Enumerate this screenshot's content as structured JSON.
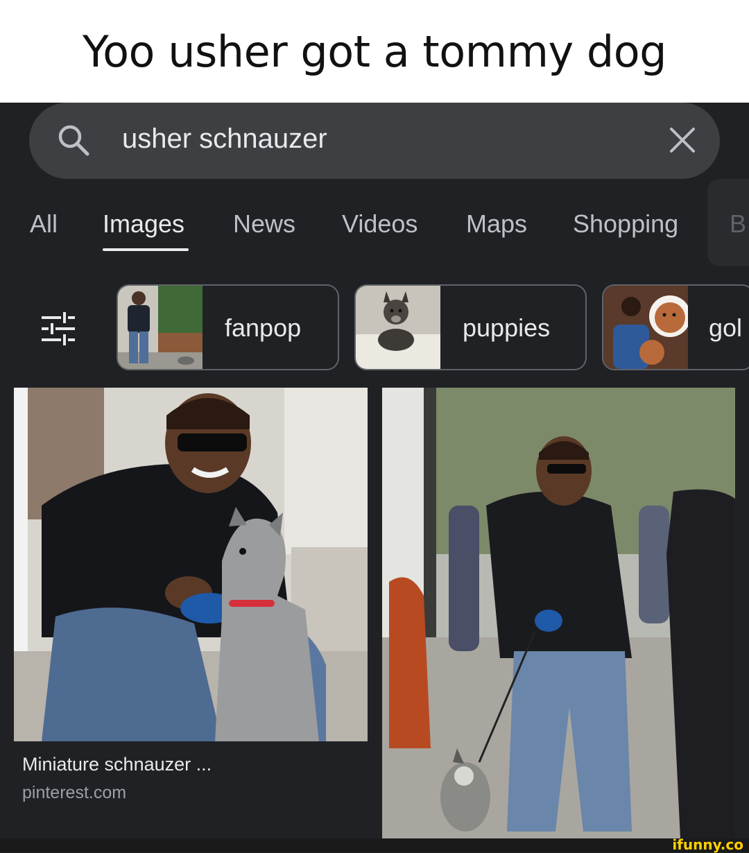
{
  "caption": "Yoo usher got a tommy dog",
  "search": {
    "query": "usher schnauzer",
    "icon": "search-icon",
    "clear_icon": "close-icon"
  },
  "tabs": [
    {
      "label": "All",
      "active": false
    },
    {
      "label": "Images",
      "active": true
    },
    {
      "label": "News",
      "active": false
    },
    {
      "label": "Videos",
      "active": false
    },
    {
      "label": "Maps",
      "active": false
    },
    {
      "label": "Shopping",
      "active": false
    },
    {
      "label": "B",
      "active": false
    }
  ],
  "filter_icon": "tune-icon",
  "chips": [
    {
      "label": "fanpop",
      "thumb": "man-with-dog-photo"
    },
    {
      "label": "puppies",
      "thumb": "schnauzer-puppy-photo"
    },
    {
      "label": "gol",
      "thumb": "man-with-golden-puppies-photo"
    }
  ],
  "results": [
    {
      "title": "Miniature schnauzer ...",
      "source": "pinterest.com"
    }
  ],
  "watermark": "ifunny.co",
  "colors": {
    "background": "#202124",
    "search_bar": "#3c4043",
    "text_primary": "#e8eaed",
    "text_secondary": "#bdc1c6",
    "chip_border": "#5f6368",
    "watermark": "#ffd000"
  }
}
